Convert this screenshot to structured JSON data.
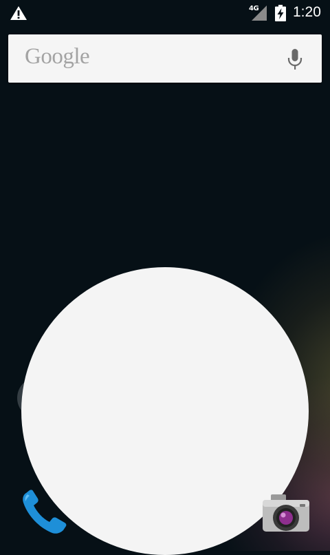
{
  "status_bar": {
    "network_type": "4G",
    "time": "1:20",
    "icons": [
      "warning-icon",
      "signal-icon",
      "battery-charging-icon"
    ]
  },
  "search": {
    "logo_text": "Google",
    "icons": [
      "mic-icon"
    ]
  },
  "dock": {
    "icons": [
      "phone-icon",
      "camera-icon"
    ]
  },
  "overlay": {
    "type": "reveal-circle",
    "color": "#f4f4f4"
  }
}
